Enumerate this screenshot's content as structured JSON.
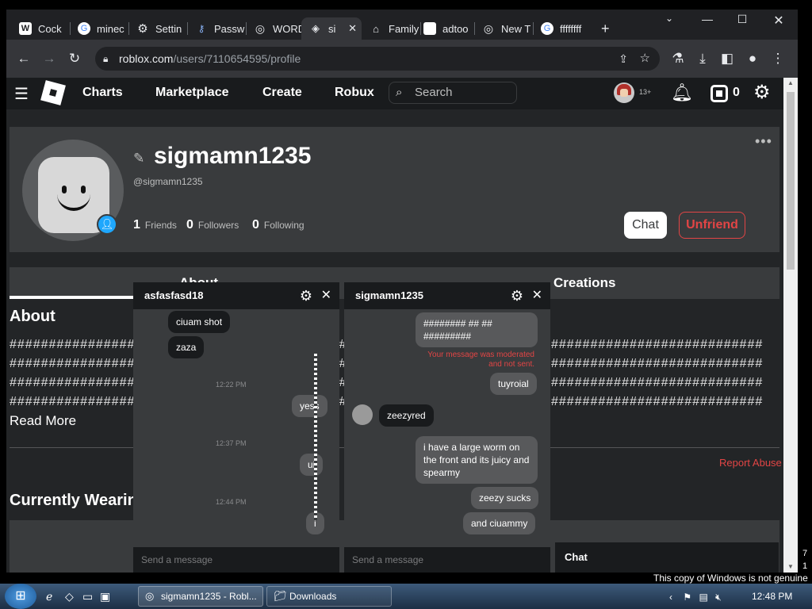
{
  "browser": {
    "tabs": [
      {
        "label": "Cock",
        "icon": "W"
      },
      {
        "label": "minec",
        "icon": "G"
      },
      {
        "label": "Settin",
        "icon": "⚙"
      },
      {
        "label": "Passw",
        "icon": "🔑"
      },
      {
        "label": "WORD",
        "icon": "◎"
      },
      {
        "label": "si",
        "icon": "◈"
      },
      {
        "label": "Family",
        "icon": "🏛"
      },
      {
        "label": "adtoo",
        "icon": "□"
      },
      {
        "label": "New T",
        "icon": "◎"
      },
      {
        "label": "ffffffff",
        "icon": "G"
      }
    ],
    "new_tab": "+",
    "url_host": "roblox.com",
    "url_path": "/users/7110654595/profile"
  },
  "nav": {
    "links": [
      "Charts",
      "Marketplace",
      "Create",
      "Robux"
    ],
    "search_placeholder": "Search",
    "avatar_badge": "13+",
    "robux_count": "0"
  },
  "profile": {
    "username": "sigmamn1235",
    "handle": "@sigmamn1235",
    "friends": {
      "count": "1",
      "label": "Friends"
    },
    "followers": {
      "count": "0",
      "label": "Followers"
    },
    "following": {
      "count": "0",
      "label": "Following"
    },
    "chat_label": "Chat",
    "unfriend_label": "Unfriend",
    "tabs": [
      "About",
      "Creations"
    ],
    "about_heading": "About",
    "about_lines": [
      "################################################################################################",
      "################################################################################################",
      "################################################################################################",
      "################################################################################################"
    ],
    "read_more": "Read More",
    "report_abuse": "Report Abuse",
    "currently_wearing": "Currently Wearing"
  },
  "chat_left": {
    "title": "asfasfasd18",
    "messages": [
      {
        "text": "ciuam shot",
        "dir": "in"
      },
      {
        "text": "zaza",
        "dir": "in"
      },
      {
        "time": "12:22 PM"
      },
      {
        "text": "yess",
        "dir": "out"
      },
      {
        "time": "12:37 PM"
      },
      {
        "text": "ui",
        "dir": "out"
      },
      {
        "time": "12:44 PM"
      },
      {
        "text": "i",
        "dir": "out"
      }
    ],
    "input_placeholder": "Send a message"
  },
  "chat_right": {
    "title": "sigmamn1235",
    "messages": [
      {
        "text": "######## ## ## #########",
        "dir": "out"
      },
      {
        "note": "Your message was moderated and not sent."
      },
      {
        "text": "tuyroial",
        "dir": "out"
      },
      {
        "text": "zeezyred",
        "dir": "in"
      },
      {
        "text": "i have a large worm on the front and its juicy and spearmy",
        "dir": "out"
      },
      {
        "text": "zeezy sucks",
        "dir": "out"
      },
      {
        "text": "and ciuammy",
        "dir": "out"
      }
    ],
    "input_placeholder": "Send a message"
  },
  "chat_bar": {
    "label": "Chat"
  },
  "taskbar": {
    "buttons": [
      "sigmamn1235 - Robl...",
      "Downloads"
    ],
    "clock": "12:48 PM",
    "genuine_notice": "This copy of Windows is not genuine",
    "side_numbers": [
      "7",
      "1"
    ]
  }
}
